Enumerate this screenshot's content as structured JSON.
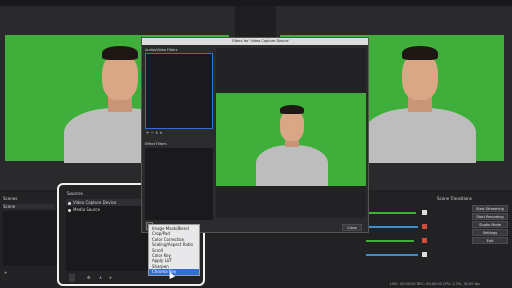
{
  "dialog": {
    "title": "Filters for 'Video Capture Device'",
    "audio_video_filters_label": "Audio/Video Filters",
    "effect_filters_label": "Effect Filters",
    "close_label": "Close"
  },
  "docks": {
    "scenes_label": "Scenes",
    "scene_item": "Scene",
    "sources_label": "Sources",
    "sources": [
      "Video Capture Device",
      "Media Source"
    ],
    "controls_label": "Scene Transitions"
  },
  "context_menu": {
    "items": [
      "Image Mask/Blend",
      "Crop/Pad",
      "Color Correction",
      "Scaling/Aspect Ratio",
      "Scroll",
      "Color Key",
      "Apply LUT",
      "Sharpen",
      "Chroma Key"
    ],
    "selected_index": 8
  },
  "controls": {
    "buttons": [
      "Start Streaming",
      "Start Recording",
      "Studio Mode",
      "Settings",
      "Exit"
    ]
  },
  "status_bar": {
    "text": "LIVE: 00:00:00   REC: 00:00:00   CPU: 2.3%, 30.00 fps"
  },
  "colors": {
    "green_screen": "#3fae3a",
    "highlight": "#2f6fd1"
  }
}
